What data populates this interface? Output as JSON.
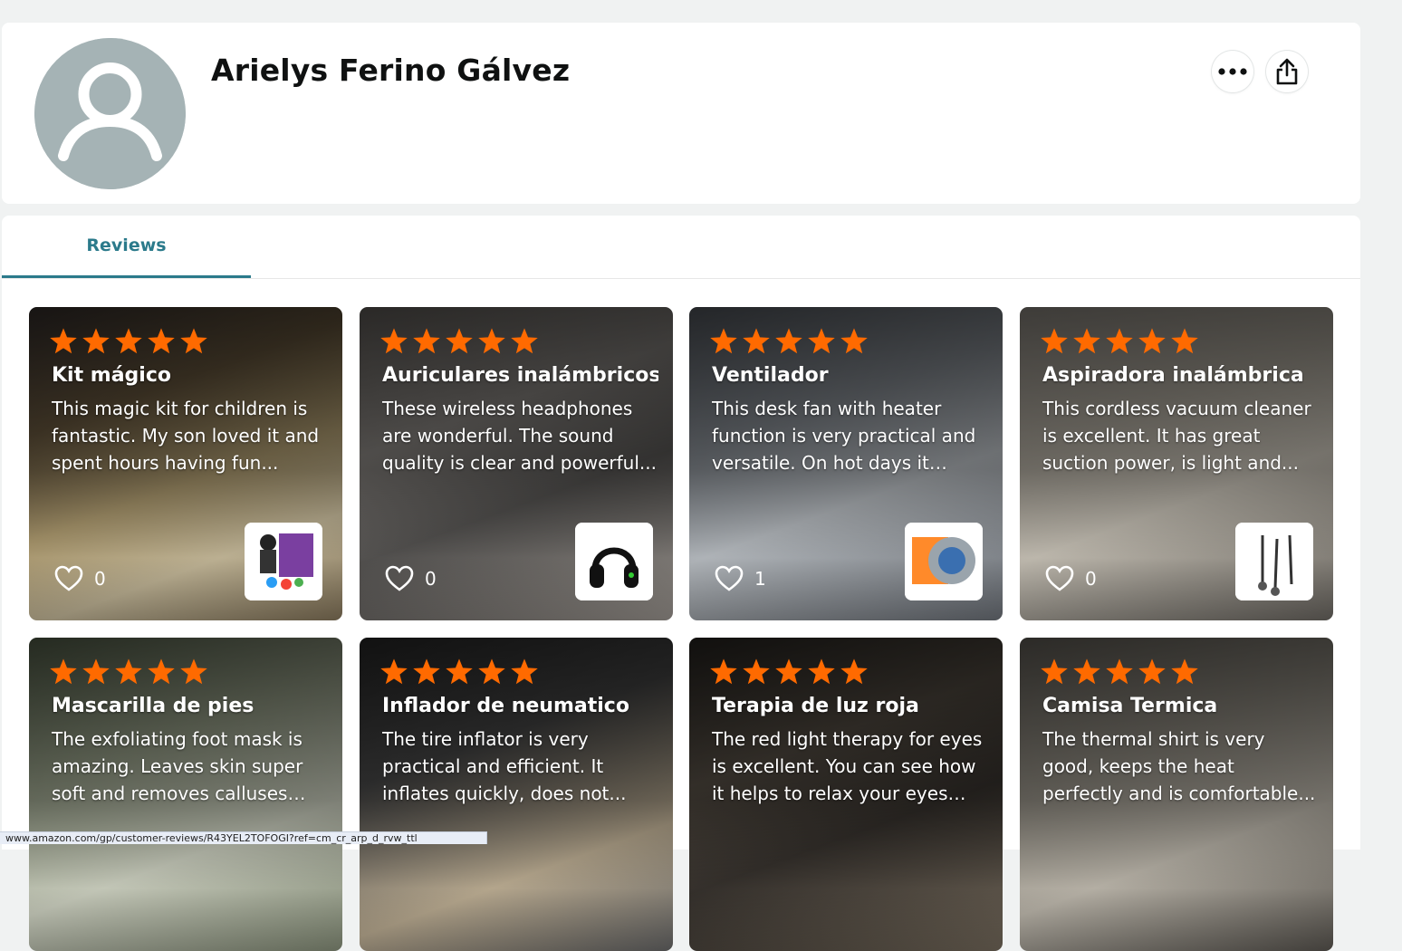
{
  "profile": {
    "name": "Arielys Ferino Gálvez"
  },
  "actions": {
    "more_icon": "more-horizontal-icon",
    "share_icon": "share-icon"
  },
  "tabs": [
    {
      "label": "Reviews",
      "active": true
    }
  ],
  "colors": {
    "accent": "#2b7a8b",
    "star": "#ff6a00",
    "avatar_bg": "#a5b3b5"
  },
  "reviews": [
    {
      "title": "Kit mágico",
      "text": "This magic kit for children is fantastic. My son loved it and spent hours having fun...",
      "rating": 5,
      "likes": "0"
    },
    {
      "title": "Auriculares inalámbricos",
      "text": "These wireless headphones are wonderful. The sound quality is clear and powerful...",
      "rating": 5,
      "likes": "0"
    },
    {
      "title": "Ventilador",
      "text": "This desk fan with heater function is very practical and versatile. On hot days it cools...",
      "rating": 5,
      "likes": "1"
    },
    {
      "title": "Aspiradora inalámbrica",
      "text": "This cordless vacuum cleaner is excellent. It has great suction power, is light and...",
      "rating": 5,
      "likes": "0"
    },
    {
      "title": "Mascarilla de pies",
      "text": "The exfoliating foot mask is amazing. Leaves skin super soft and removes calluses and...",
      "rating": 5,
      "likes": ""
    },
    {
      "title": "Inflador de neumatico",
      "text": "The tire inflator is very practical and efficient. It inflates quickly, does not...",
      "rating": 5,
      "likes": ""
    },
    {
      "title": "Terapia de luz roja",
      "text": "The red light therapy for eyes is excellent. You can see how it helps to relax your eyes and...",
      "rating": 5,
      "likes": ""
    },
    {
      "title": "Camisa Termica",
      "text": "The thermal shirt is very good, keeps the heat perfectly and is comfortable...",
      "rating": 5,
      "likes": ""
    }
  ],
  "status_bar": {
    "url": "www.amazon.com/gp/customer-reviews/R43YEL2TOFOGI?ref=cm_cr_arp_d_rvw_ttl"
  }
}
